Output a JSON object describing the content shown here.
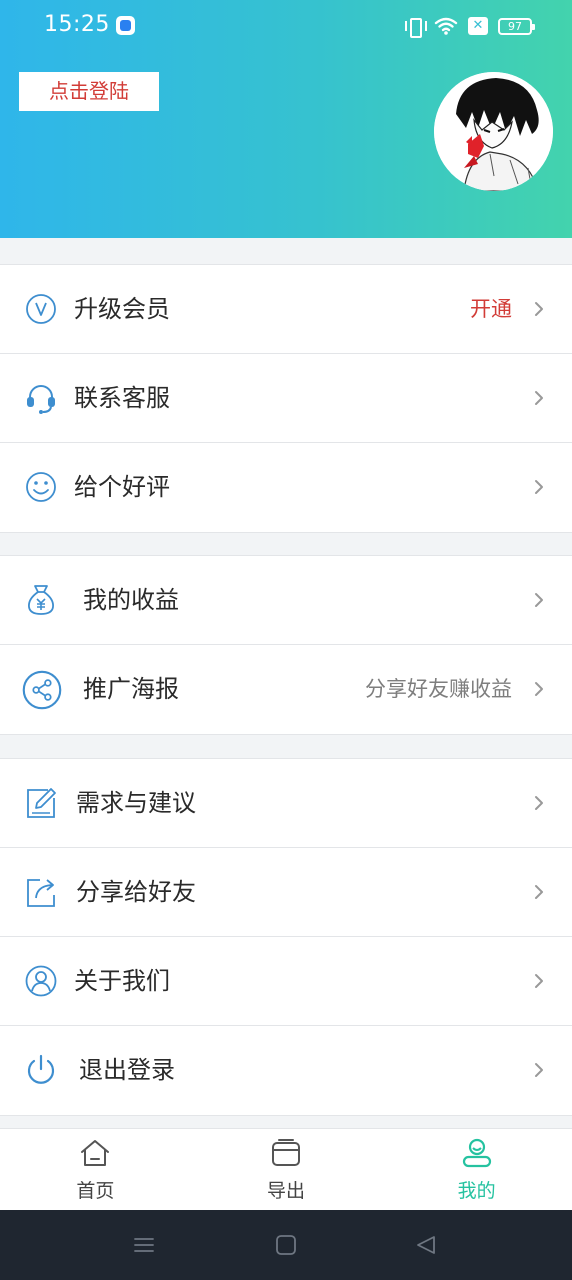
{
  "status_bar": {
    "time": "15:25",
    "battery": "97",
    "sim_badge": "✕"
  },
  "header": {
    "login_label": "点击登陆",
    "gradient_start": "#2fb6ea",
    "gradient_end": "#43d3ad"
  },
  "menu": {
    "group1": [
      {
        "label": "升级会员",
        "value": "开通",
        "icon": "vip-icon"
      },
      {
        "label": "联系客服",
        "value": "",
        "icon": "headset-icon"
      },
      {
        "label": "给个好评",
        "value": "",
        "icon": "smile-icon"
      }
    ],
    "group2": [
      {
        "label": "我的收益",
        "value": "",
        "icon": "money-bag-icon"
      },
      {
        "label": "推广海报",
        "value": "分享好友赚收益",
        "icon": "share-nodes-icon"
      }
    ],
    "group3": [
      {
        "label": "需求与建议",
        "value": "",
        "icon": "edit-icon"
      },
      {
        "label": "分享给好友",
        "value": "",
        "icon": "share-out-icon"
      },
      {
        "label": "关于我们",
        "value": "",
        "icon": "user-circle-icon"
      },
      {
        "label": "退出登录",
        "value": "",
        "icon": "power-icon"
      }
    ]
  },
  "tabs": [
    {
      "label": "首页",
      "icon": "home-icon",
      "active": false
    },
    {
      "label": "导出",
      "icon": "box-icon",
      "active": false
    },
    {
      "label": "我的",
      "icon": "profile-icon",
      "active": true
    }
  ],
  "colors": {
    "accent_red": "#d23c37",
    "icon_blue": "#3e8ecf",
    "active_green": "#25c2a0"
  }
}
